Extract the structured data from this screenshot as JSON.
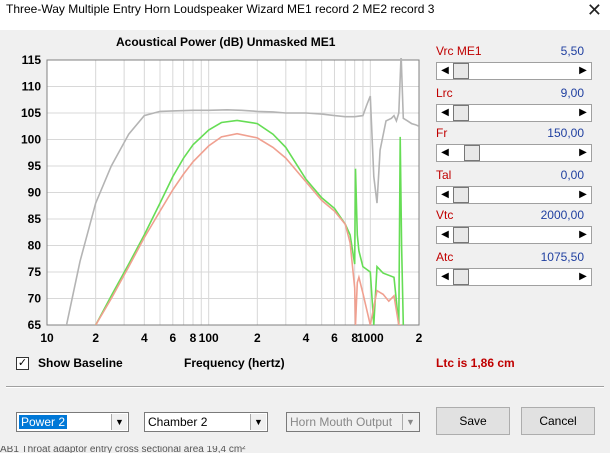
{
  "window": {
    "title": "Three-Way Multiple Entry Horn Loudspeaker Wizard   ME1 record 2   ME2 record 3"
  },
  "chart": {
    "title": "Acoustical Power (dB)   Unmasked   ME1"
  },
  "chart_data": {
    "type": "line",
    "title": "Acoustical Power (dB)   Unmasked   ME1",
    "xlabel": "Frequency (hertz)",
    "ylabel": "",
    "xscale": "log",
    "xlim": [
      10,
      2000
    ],
    "ylim": [
      65,
      115
    ],
    "grid": true,
    "y_ticks": [
      65,
      70,
      75,
      80,
      85,
      90,
      95,
      100,
      105,
      110,
      115
    ],
    "x_tick_labels": [
      {
        "value": 10,
        "label": "10"
      },
      {
        "value": 20,
        "label": "2"
      },
      {
        "value": 40,
        "label": "4"
      },
      {
        "value": 60,
        "label": "6"
      },
      {
        "value": 80,
        "label": "8"
      },
      {
        "value": 100,
        "label": "100"
      },
      {
        "value": 200,
        "label": "2"
      },
      {
        "value": 400,
        "label": "4"
      },
      {
        "value": 600,
        "label": "6"
      },
      {
        "value": 800,
        "label": "8"
      },
      {
        "value": 1000,
        "label": "1000"
      },
      {
        "value": 2000,
        "label": "2"
      }
    ],
    "series": [
      {
        "color": "#b4b4b4",
        "x": [
          10,
          13,
          16,
          20,
          25,
          32,
          40,
          50,
          60,
          80,
          100,
          130,
          160,
          200,
          250,
          300,
          400,
          500,
          600,
          700,
          800,
          900,
          950,
          1000,
          1050,
          1100,
          1150,
          1250,
          1350,
          1400,
          1450,
          1500,
          1550,
          1600,
          1700,
          1800,
          1900,
          2000
        ],
        "y": [
          50,
          64,
          77,
          88,
          95,
          101,
          104.5,
          105.3,
          105.4,
          105.5,
          105.5,
          105.6,
          105.5,
          105.3,
          105.2,
          105,
          105,
          104.8,
          104.5,
          104.3,
          104.3,
          104.5,
          106.5,
          108.2,
          93,
          88,
          98,
          103.5,
          104,
          104.5,
          103.5,
          105,
          116,
          104,
          103.5,
          103,
          102.8,
          102.5
        ]
      },
      {
        "color": "#66dd55",
        "x": [
          20,
          25,
          32,
          40,
          50,
          60,
          70,
          80,
          100,
          120,
          150,
          200,
          250,
          300,
          400,
          500,
          600,
          700,
          750,
          800,
          810,
          830,
          850,
          900,
          1000,
          1050,
          1100,
          1200,
          1400,
          1500,
          1530,
          1560,
          1600
        ],
        "y": [
          65,
          70.5,
          76.5,
          82,
          88,
          93,
          96.5,
          99,
          101.8,
          103.2,
          103.6,
          103,
          101,
          98.5,
          92.5,
          89,
          87,
          84,
          82,
          76.5,
          94.5,
          82,
          79,
          76,
          75,
          65,
          76,
          74.8,
          74,
          65,
          100.5,
          80,
          65
        ]
      },
      {
        "color": "#f0a090",
        "x": [
          20,
          25,
          32,
          40,
          50,
          60,
          70,
          80,
          100,
          120,
          150,
          200,
          250,
          300,
          400,
          500,
          600,
          700,
          750,
          800,
          810,
          830,
          850,
          900,
          1000,
          1100,
          1200,
          1300,
          1400,
          1500,
          1550
        ],
        "y": [
          65,
          70,
          76,
          81.5,
          86.5,
          90.5,
          93.5,
          95.8,
          98.8,
          100.5,
          101.1,
          100.3,
          98.5,
          96.5,
          92,
          88.5,
          86.5,
          84,
          80.5,
          72,
          65,
          73,
          74,
          71,
          65,
          71.5,
          70.8,
          69.5,
          70.5,
          65,
          65
        ]
      }
    ]
  },
  "params": [
    {
      "label": "Vrc  ME1",
      "value": "5,50",
      "level": 0.0
    },
    {
      "label": "Lrc",
      "value": "9,00",
      "level": 0.0
    },
    {
      "label": "Fr",
      "value": "150,00",
      "level": 0.1
    },
    {
      "label": "Tal",
      "value": "0,00",
      "level": 0.0
    },
    {
      "label": "Vtc",
      "value": "2000,00",
      "level": 0.0
    },
    {
      "label": "Atc",
      "value": "1075,50",
      "level": 0.0
    }
  ],
  "show_baseline": {
    "label": "Show Baseline",
    "checked": true,
    "check_glyph": "✓"
  },
  "xaxis_label": "Frequency (hertz)",
  "status": "Ltc is 1,86 cm",
  "combos": {
    "power": "Power 2",
    "chamber": "Chamber 2",
    "horn": "Horn Mouth Output"
  },
  "buttons": {
    "save": "Save",
    "cancel": "Cancel"
  },
  "icons": {
    "close": "✕",
    "dropdown": "▼",
    "left": "◀",
    "right": "▶"
  },
  "footer": "AB1   Throat adaptor entry cross sectional area  19,4 cm²"
}
